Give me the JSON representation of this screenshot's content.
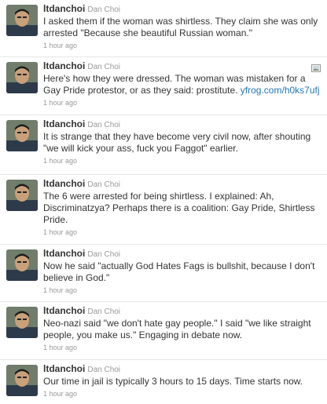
{
  "tweets": [
    {
      "screen_name": "ltdanchoi",
      "full_name": "Dan Choi",
      "text": "I asked them if the woman was shirtless. They claim she was only arrested \"Because she beautiful Russian woman.\"",
      "time": "1 hour ago"
    },
    {
      "screen_name": "ltdanchoi",
      "full_name": "Dan Choi",
      "text": "Here's how they were dressed. The woman was mistaken for a Gay Pride protestor, or as they said: prostitute. ",
      "link": "yfrog.com/h0ks7ufj",
      "time": "1 hour ago",
      "media_icon": "image-icon"
    },
    {
      "screen_name": "ltdanchoi",
      "full_name": "Dan Choi",
      "text": "It is strange that they have become very civil now, after shouting \"we will kick your ass, fuck you Faggot\" earlier.",
      "time": "1 hour ago"
    },
    {
      "screen_name": "ltdanchoi",
      "full_name": "Dan Choi",
      "text": "The 6 were arrested for being shirtless. I explained: Ah, Discriminatzya? Perhaps there is a coalition: Gay Pride, Shirtless Pride.",
      "time": "1 hour ago"
    },
    {
      "screen_name": "ltdanchoi",
      "full_name": "Dan Choi",
      "text": "Now he said \"actually God Hates Fags is bullshit, because I don't believe in God.\"",
      "time": "1 hour ago"
    },
    {
      "screen_name": "ltdanchoi",
      "full_name": "Dan Choi",
      "text": "Neo-nazi said \"we don't hate gay people.\" I said \"we like straight people, you make us.\" Engaging in debate now.",
      "time": "1 hour ago"
    },
    {
      "screen_name": "ltdanchoi",
      "full_name": "Dan Choi",
      "text": "Our time in jail is typically 3 hours to 15 days. Time starts now.",
      "time": "1 hour ago"
    }
  ],
  "colors": {
    "link": "#2276bb",
    "text": "#333333",
    "muted": "#999999",
    "divider": "#e6e6e6"
  }
}
